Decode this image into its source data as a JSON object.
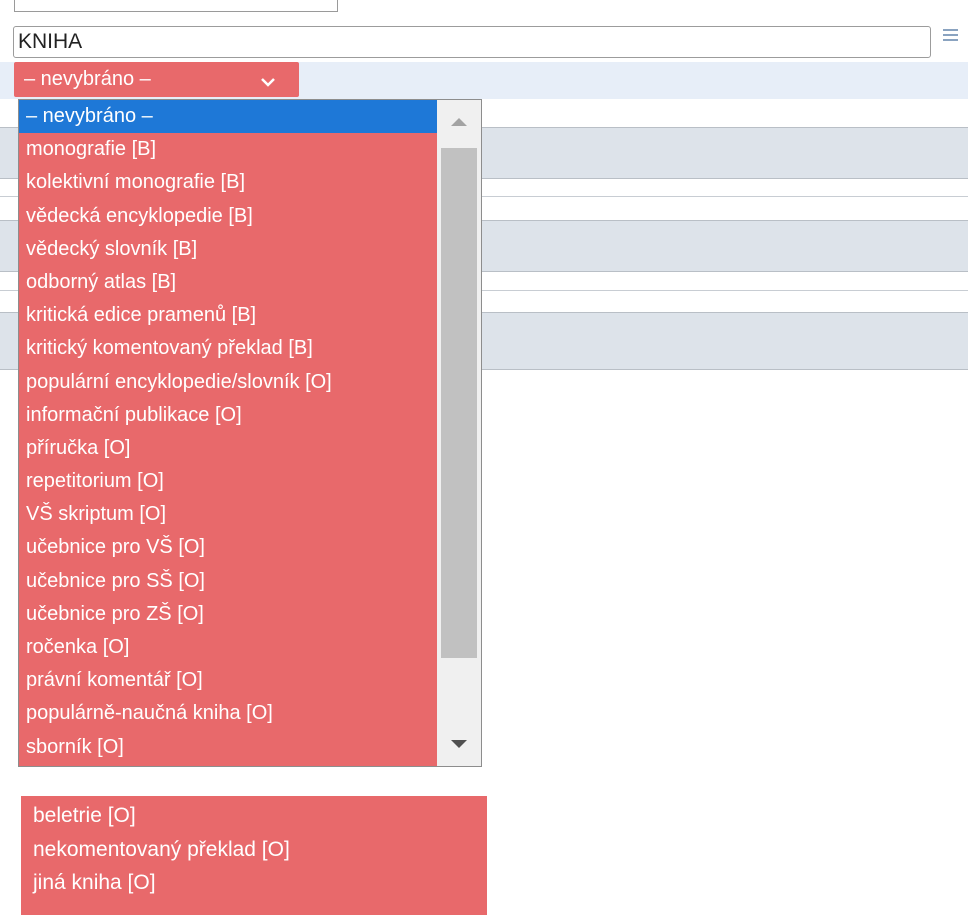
{
  "field": {
    "value": "KNIHA"
  },
  "select": {
    "selected_label": "– nevybráno –"
  },
  "dropdown": {
    "options": [
      "– nevybráno –",
      "monografie [B]",
      "kolektivní monografie [B]",
      "vědecká encyklopedie [B]",
      "vědecký slovník [B]",
      "odborný atlas [B]",
      "kritická edice pramenů [B]",
      "kritický komentovaný překlad [B]",
      "populární encyklopedie/slovník [O]",
      "informační publikace [O]",
      "příručka [O]",
      "repetitorium [O]",
      "VŠ skriptum [O]",
      "učebnice pro VŠ [O]",
      "učebnice pro SŠ [O]",
      "učebnice pro ZŠ [O]",
      "ročenka [O]",
      "právní komentář [O]",
      "populárně-naučná kniha [O]",
      "sborník [O]"
    ]
  },
  "lower_list": {
    "options": [
      "beletrie [O]",
      "nekomentovaný překlad [O]",
      "jiná kniha [O]"
    ]
  },
  "colors": {
    "dropdown_bg": "#e8696b",
    "selected_bg": "#1e78d7",
    "select_bar_bg": "#e7eef8"
  },
  "icons": {
    "menu": "hamburger-icon",
    "select_chevron": "chevron-down-icon",
    "scroll_up": "triangle-up-icon",
    "scroll_down": "triangle-down-icon"
  }
}
